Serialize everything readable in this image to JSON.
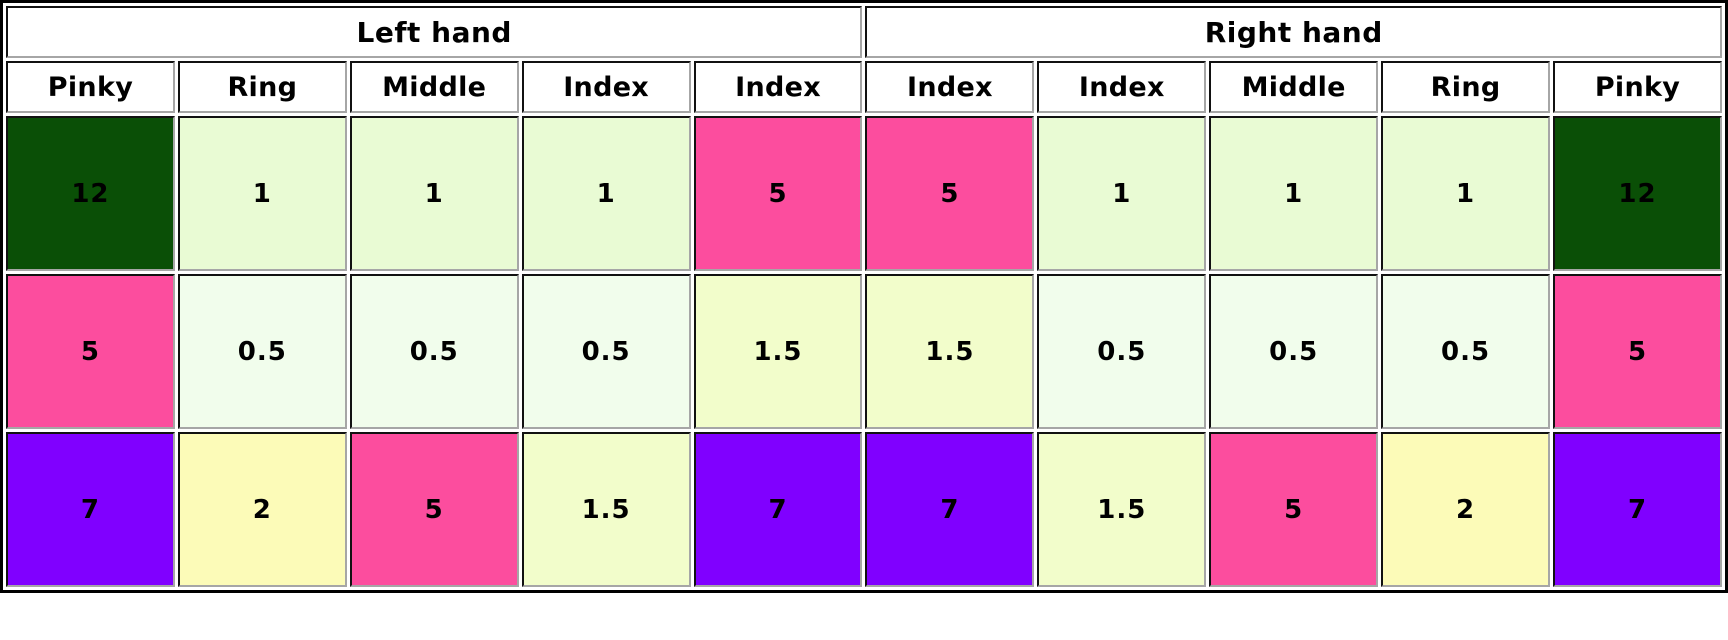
{
  "table": {
    "group_headers": [
      {
        "label": "Left hand",
        "span": 5
      },
      {
        "label": "Right hand",
        "span": 5
      }
    ],
    "column_headers": [
      "Pinky",
      "Ring",
      "Middle",
      "Index",
      "Index",
      "Index",
      "Index",
      "Middle",
      "Ring",
      "Pinky"
    ],
    "rows": [
      {
        "cells": [
          {
            "value": "12",
            "color_class": "c-darkgreen",
            "color": "#0a4f06"
          },
          {
            "value": "1",
            "color_class": "c-palegreen",
            "color": "#e9fbd4"
          },
          {
            "value": "1",
            "color_class": "c-palegreen",
            "color": "#e9fbd4"
          },
          {
            "value": "1",
            "color_class": "c-palegreen",
            "color": "#e9fbd4"
          },
          {
            "value": "5",
            "color_class": "c-pink",
            "color": "#fc4d9e"
          },
          {
            "value": "5",
            "color_class": "c-pink",
            "color": "#fc4d9e"
          },
          {
            "value": "1",
            "color_class": "c-palegreen",
            "color": "#e9fbd4"
          },
          {
            "value": "1",
            "color_class": "c-palegreen",
            "color": "#e9fbd4"
          },
          {
            "value": "1",
            "color_class": "c-palegreen",
            "color": "#e9fbd4"
          },
          {
            "value": "12",
            "color_class": "c-darkgreen",
            "color": "#0a4f06"
          }
        ]
      },
      {
        "cells": [
          {
            "value": "5",
            "color_class": "c-pink",
            "color": "#fc4d9e"
          },
          {
            "value": "0.5",
            "color_class": "c-paleryellow",
            "color": "#f1fdec"
          },
          {
            "value": "0.5",
            "color_class": "c-paleryellow",
            "color": "#f1fdec"
          },
          {
            "value": "0.5",
            "color_class": "c-paleryellow",
            "color": "#f1fdec"
          },
          {
            "value": "1.5",
            "color_class": "c-yellowgreen",
            "color": "#f2fdcb"
          },
          {
            "value": "1.5",
            "color_class": "c-yellowgreen",
            "color": "#f2fdcb"
          },
          {
            "value": "0.5",
            "color_class": "c-paleryellow",
            "color": "#f1fdec"
          },
          {
            "value": "0.5",
            "color_class": "c-paleryellow",
            "color": "#f1fdec"
          },
          {
            "value": "0.5",
            "color_class": "c-paleryellow",
            "color": "#f1fdec"
          },
          {
            "value": "5",
            "color_class": "c-pink",
            "color": "#fc4d9e"
          }
        ]
      },
      {
        "cells": [
          {
            "value": "7",
            "color_class": "c-violet",
            "color": "#8000ff"
          },
          {
            "value": "2",
            "color_class": "c-yellow",
            "color": "#fcfbb8"
          },
          {
            "value": "5",
            "color_class": "c-pink",
            "color": "#fc4d9e"
          },
          {
            "value": "1.5",
            "color_class": "c-yellowgreen",
            "color": "#f2fdcb"
          },
          {
            "value": "7",
            "color_class": "c-violet",
            "color": "#8000ff"
          },
          {
            "value": "7",
            "color_class": "c-violet",
            "color": "#8000ff"
          },
          {
            "value": "1.5",
            "color_class": "c-yellowgreen",
            "color": "#f2fdcb"
          },
          {
            "value": "5",
            "color_class": "c-pink",
            "color": "#fc4d9e"
          },
          {
            "value": "2",
            "color_class": "c-yellow",
            "color": "#fcfbb8"
          },
          {
            "value": "7",
            "color_class": "c-violet",
            "color": "#8000ff"
          }
        ]
      }
    ]
  }
}
